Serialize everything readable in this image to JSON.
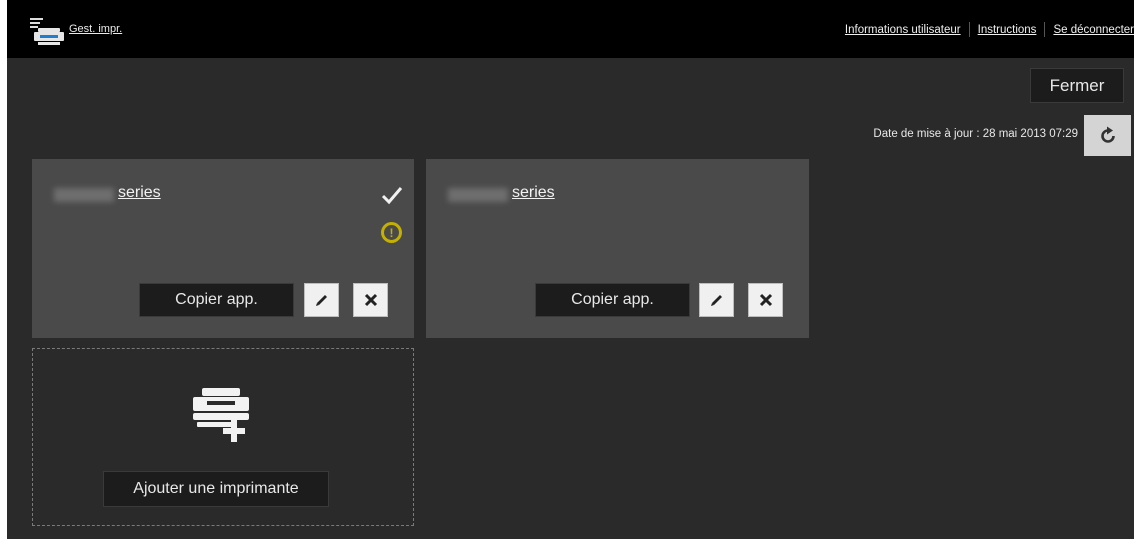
{
  "header": {
    "app_link": "Gest. impr.",
    "nav": {
      "user_info": "Informations utilisateur",
      "instructions": "Instructions",
      "logout": "Se déconnecter"
    }
  },
  "close_label": "Fermer",
  "update_label": "Date de mise à jour : 28 mai 2013 07:29",
  "printers": [
    {
      "name_suffix": "series",
      "copy_label": "Copier app.",
      "status_ok": true,
      "status_warning": true
    },
    {
      "name_suffix": "series",
      "copy_label": "Copier app.",
      "status_ok": false,
      "status_warning": false
    }
  ],
  "add_printer_label": "Ajouter une imprimante",
  "icons": {
    "logo": "printer-app-icon",
    "refresh": "refresh-icon",
    "check": "checkmark-icon",
    "warning": "warning-icon",
    "edit": "pencil-icon",
    "delete": "close-icon",
    "add_printer": "printer-plus-icon"
  },
  "colors": {
    "header_bg": "#000000",
    "page_bg": "#2a2a2a",
    "card_bg": "#4a4a4a",
    "warning": "#c4b000"
  }
}
